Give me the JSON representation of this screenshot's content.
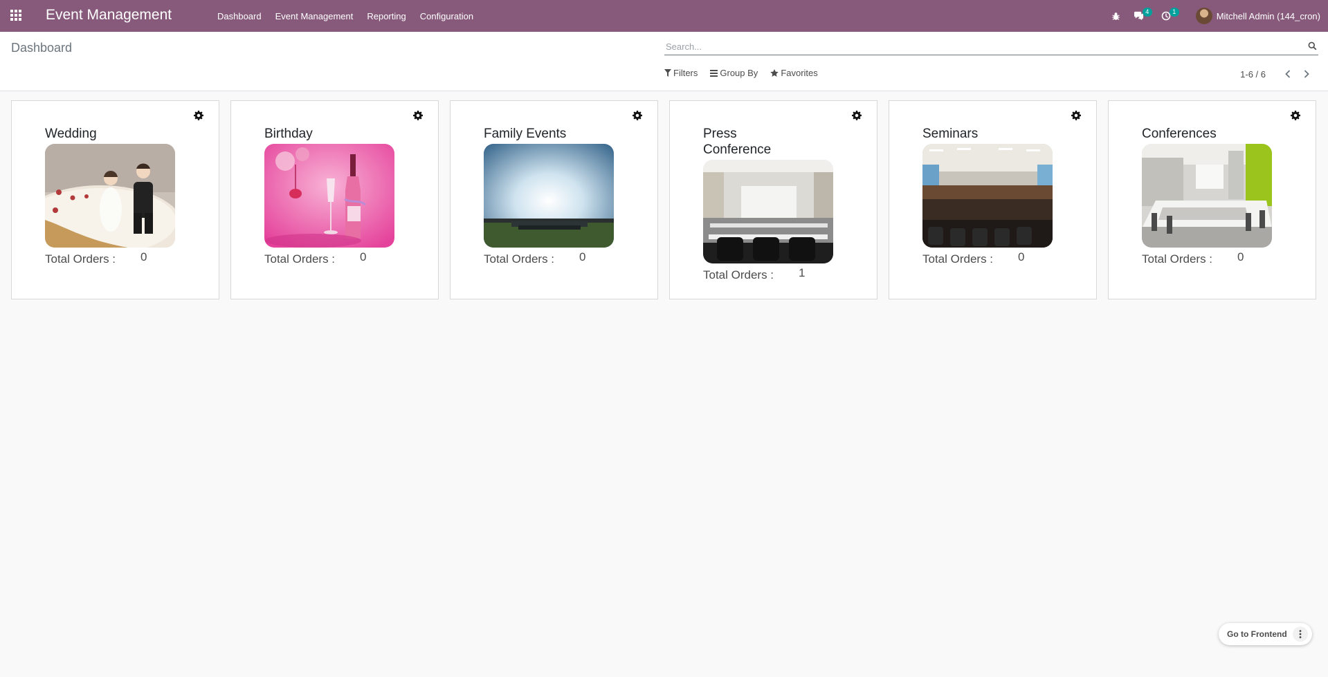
{
  "navbar": {
    "app_title": "Event Management",
    "menu": [
      "Dashboard",
      "Event Management",
      "Reporting",
      "Configuration"
    ],
    "messages_count": "4",
    "activities_count": "1",
    "user_name": "Mitchell Admin (144_cron)"
  },
  "control_panel": {
    "breadcrumb": "Dashboard",
    "search_placeholder": "Search...",
    "filters_label": "Filters",
    "group_by_label": "Group By",
    "favorites_label": "Favorites",
    "pager_value": "1-6 / 6"
  },
  "cards": [
    {
      "title": "Wedding",
      "orders_label": "Total Orders :",
      "orders_value": "0",
      "image": "wedding-cake-image"
    },
    {
      "title": "Birthday",
      "orders_label": "Total Orders :",
      "orders_value": "0",
      "image": "birthday-wine-image"
    },
    {
      "title": "Family Events",
      "orders_label": "Total Orders :",
      "orders_value": "0",
      "image": "family-crowd-image"
    },
    {
      "title": "Press Conference",
      "orders_label": "Total Orders :",
      "orders_value": "1",
      "image": "conference-hall-image"
    },
    {
      "title": "Seminars",
      "orders_label": "Total Orders :",
      "orders_value": "0",
      "image": "seminar-room-image"
    },
    {
      "title": "Conferences",
      "orders_label": "Total Orders :",
      "orders_value": "0",
      "image": "meeting-room-image"
    }
  ],
  "footer": {
    "go_to_frontend_label": "Go to Frontend"
  },
  "colors": {
    "navbar": "#875a7b",
    "badge": "#00a09d",
    "background": "#f9f9f9"
  }
}
